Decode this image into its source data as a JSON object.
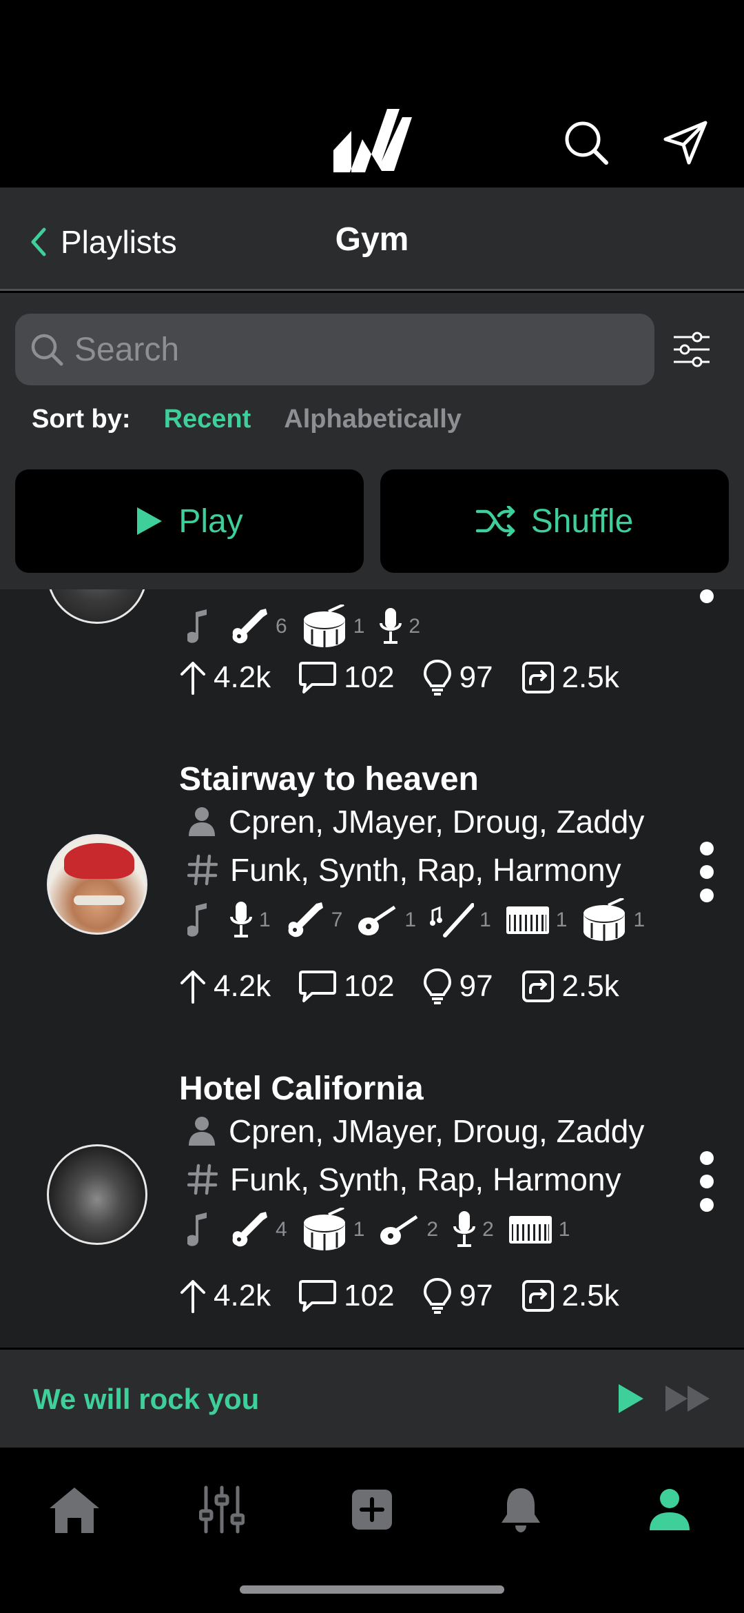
{
  "nav": {
    "back_label": "Playlists",
    "title": "Gym"
  },
  "search": {
    "placeholder": "Search"
  },
  "sort": {
    "label": "Sort by:",
    "options": [
      "Recent",
      "Alphabetically"
    ],
    "selected": "Recent"
  },
  "actions": {
    "play_label": "Play",
    "shuffle_label": "Shuffle"
  },
  "accent_color": "#3ecf9b",
  "songs": [
    {
      "instruments": [
        {
          "icon": "music-note-icon",
          "count": ""
        },
        {
          "icon": "electric-guitar-icon",
          "count": "6"
        },
        {
          "icon": "drum-icon",
          "count": "1"
        },
        {
          "icon": "microphone-icon",
          "count": "2"
        }
      ],
      "stats": {
        "upvotes": "4.2k",
        "comments": "102",
        "ideas": "97",
        "shares": "2.5k"
      }
    },
    {
      "title": "Stairway to heaven",
      "artists": "Cpren, JMayer, Droug, Zaddy",
      "tags": "Funk, Synth, Rap, Harmony",
      "instruments": [
        {
          "icon": "music-note-icon",
          "count": ""
        },
        {
          "icon": "microphone-icon",
          "count": "1"
        },
        {
          "icon": "electric-guitar-icon",
          "count": "7"
        },
        {
          "icon": "acoustic-guitar-icon",
          "count": "1"
        },
        {
          "icon": "flute-icon",
          "count": "1"
        },
        {
          "icon": "keyboard-icon",
          "count": "1"
        },
        {
          "icon": "drum-icon",
          "count": "1"
        }
      ],
      "stats": {
        "upvotes": "4.2k",
        "comments": "102",
        "ideas": "97",
        "shares": "2.5k"
      }
    },
    {
      "title": "Hotel California",
      "artists": "Cpren, JMayer, Droug, Zaddy",
      "tags": "Funk, Synth, Rap, Harmony",
      "instruments": [
        {
          "icon": "music-note-icon",
          "count": ""
        },
        {
          "icon": "electric-guitar-icon",
          "count": "4"
        },
        {
          "icon": "drum-icon",
          "count": "1"
        },
        {
          "icon": "acoustic-guitar-icon",
          "count": "2"
        },
        {
          "icon": "microphone-icon",
          "count": "2"
        },
        {
          "icon": "keyboard-icon",
          "count": "1"
        }
      ],
      "stats": {
        "upvotes": "4.2k",
        "comments": "102",
        "ideas": "97",
        "shares": "2.5k"
      }
    }
  ],
  "now_playing": {
    "title": "We will rock you"
  },
  "tabs": [
    "home-icon",
    "mixer-icon",
    "add-icon",
    "bell-icon",
    "profile-icon"
  ],
  "active_tab": "profile-icon"
}
